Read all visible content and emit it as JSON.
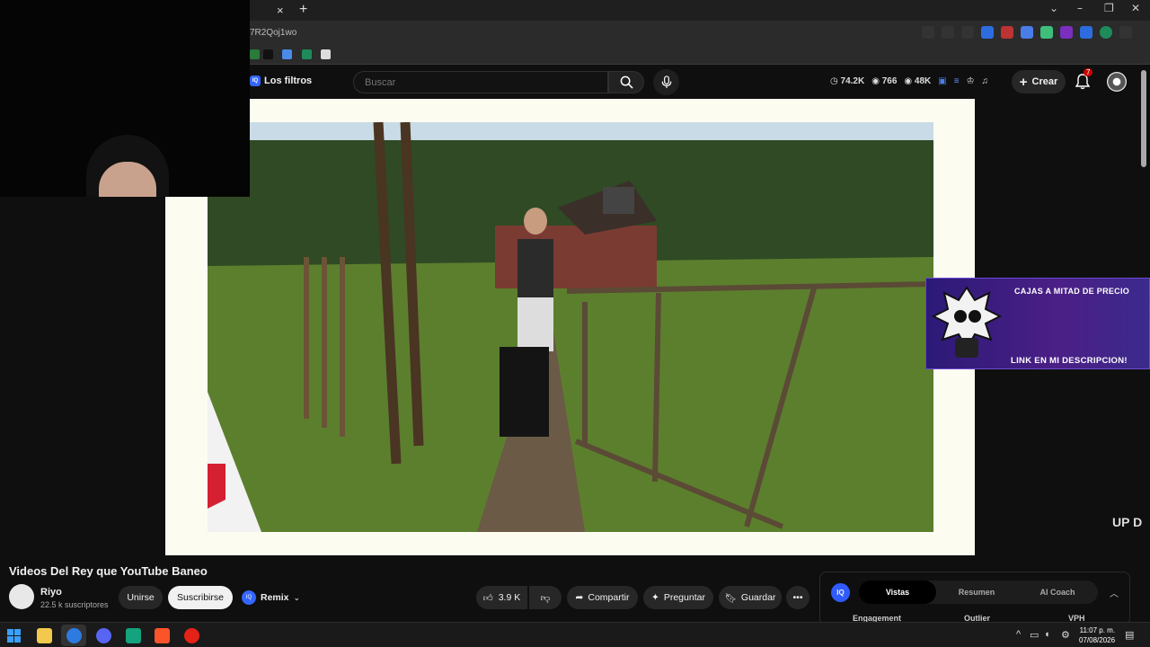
{
  "browser": {
    "url_fragment": "7R2Qoj1wo",
    "tab_close": "×",
    "tab_new": "+"
  },
  "header": {
    "filters_label": "Los filtros",
    "filters_badge": "IQ",
    "search_placeholder": "Buscar",
    "stats": [
      {
        "icon": "clock-icon",
        "value": "74.2K"
      },
      {
        "icon": "eye-icon",
        "value": "766"
      },
      {
        "icon": "eye-icon",
        "value": "48K"
      }
    ],
    "create_label": "Crear",
    "notifications_count": "7"
  },
  "ad_banner": {
    "top_text": "CAJAS A MITAD DE PRECIO",
    "bottom_text": "LINK EN MI DESCRIPCION!"
  },
  "corner_logo": "UP D",
  "video": {
    "title": "Videos Del Rey que YouTube Baneo",
    "channel_name": "Riyo",
    "subscribers": "22.5 k suscriptores",
    "join_label": "Unirse",
    "subscribe_label": "Suscribirse",
    "remix_label": "Remix",
    "likes": "3.9 K",
    "share_label": "Compartir",
    "ask_label": "Preguntar",
    "save_label": "Guardar"
  },
  "analytics_panel": {
    "logo": "IQ",
    "tabs": [
      "Vistas",
      "Resumen",
      "AI Coach"
    ],
    "active_tab": "Vistas",
    "columns": [
      "Engagement",
      "Outlier",
      "VPH"
    ]
  },
  "taskbar": {
    "time": "11:07 p. m.",
    "date": "07/08/2026"
  },
  "colors": {
    "background": "#0f0f0f",
    "player_frame": "#fcfcf1",
    "ad_purple": "#3b2a8c",
    "iq_blue": "#2f5bff",
    "notification_red": "#cc0000"
  }
}
